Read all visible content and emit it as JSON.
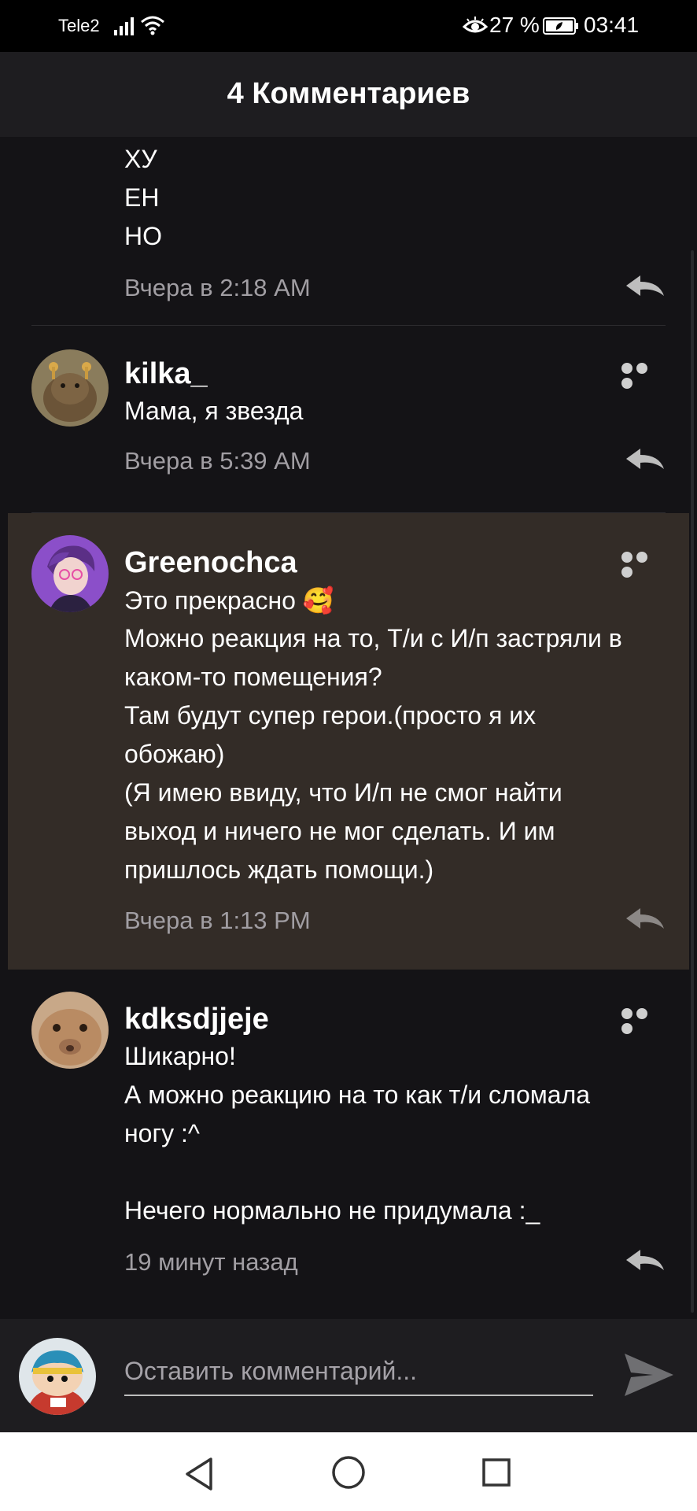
{
  "status_bar": {
    "carrier": "Tele2",
    "battery_percent": "27 %",
    "time": "03:41",
    "icons": [
      "signal-icon",
      "wifi-icon",
      "eye-comfort-icon",
      "battery-saver-icon"
    ]
  },
  "header": {
    "title": "4 Комментариев"
  },
  "comments": [
    {
      "author": "",
      "lines": [
        "ХУ",
        "ЕН",
        "НО"
      ],
      "timestamp": "Вчера в 2:18 AM"
    },
    {
      "author": "kilka_",
      "lines": [
        "Мама, я звезда"
      ],
      "timestamp": "Вчера в 5:39 AM"
    },
    {
      "author": "Greenochca",
      "lines": [
        "Это прекрасно",
        "Можно реакция на то, Т/и с И/п застряли в",
        "каком-то помещения?",
        "Там будут супер герои.(просто я их",
        "обожаю)",
        "(Я имею ввиду, что И/п не смог найти",
        "выход и ничего не мог сделать. И им",
        "пришлось ждать помощи.)"
      ],
      "emoji": "🥰",
      "timestamp": "Вчера в 1:13 PM",
      "highlighted": true
    },
    {
      "author": "kdksdjjeje",
      "lines": [
        "Шикарно!",
        "А можно реакцию на то как т/и сломала",
        "ногу :^",
        "",
        "Нечего нормально не придумала :_"
      ],
      "timestamp": "19 минут назад"
    }
  ],
  "composer": {
    "placeholder": "Оставить комментарий..."
  },
  "colors": {
    "background": "#141316",
    "header": "#1e1d20",
    "highlight": "#332c27",
    "timestamp": "#a19ea3"
  }
}
